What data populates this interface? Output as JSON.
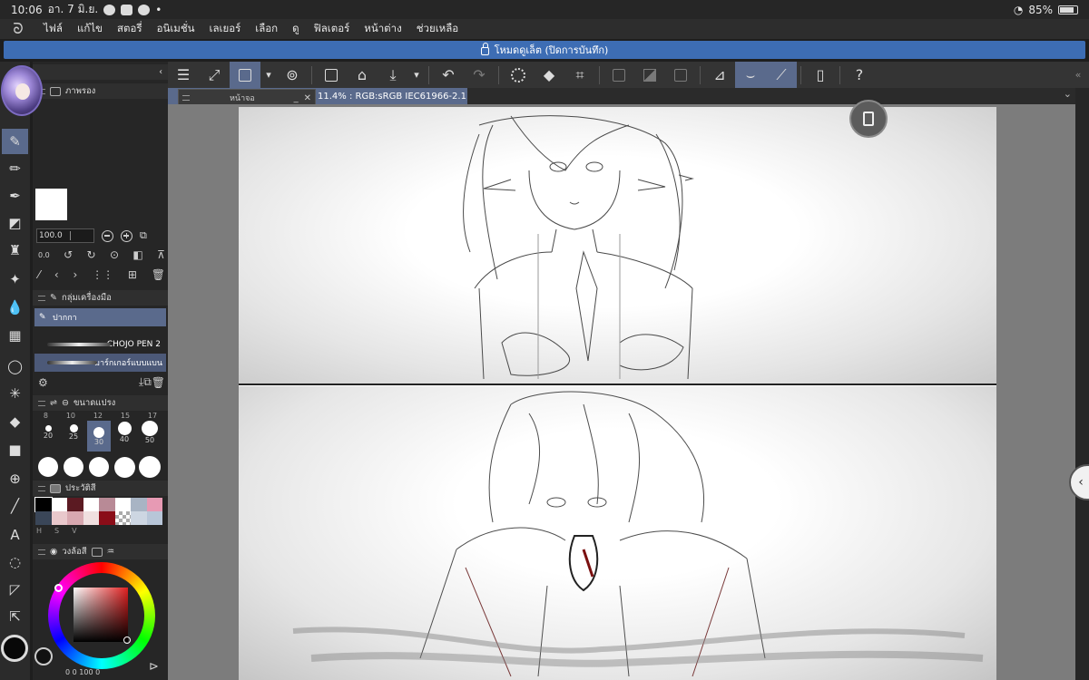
{
  "status_bar": {
    "time": "10:06",
    "date": "อา. 7 มิ.ย.",
    "battery": "85%"
  },
  "menu": [
    "ไฟล์",
    "แก้ไข",
    "สตอรี่",
    "อนิเมชั่น",
    "เลเยอร์",
    "เลือก",
    "ดู",
    "ฟิลเตอร์",
    "หน้าต่าง",
    "ช่วยเหลือ"
  ],
  "banner": {
    "text": "โหมดดูเล็ต (ปิดการบันทึก)"
  },
  "document_tab": {
    "title": "11.4% : RGB:sRGB IEC61966-2.1)",
    "modified": "●"
  },
  "navigator": {
    "title": "หน้าจอ"
  },
  "layer_panel": {
    "title": "ภาพรอง",
    "opacity": "100.0",
    "angle": "0.0"
  },
  "subtool_panel": {
    "title": "กลุ่มเครื่องมือ",
    "items": [
      {
        "label": "ปากกา"
      },
      {
        "label": "CHOJO PEN 2"
      },
      {
        "label": "มาร์กเกอร์แบบแบน"
      }
    ]
  },
  "brush_size_panel": {
    "title": "ขนาดแปรง",
    "top_row": [
      "8",
      "10",
      "12",
      "15",
      "17"
    ],
    "row1": [
      "20",
      "25",
      "30",
      "40",
      "50"
    ],
    "selected": "30"
  },
  "color_history_panel": {
    "title": "ประวัติสี",
    "swatches": [
      "#000000",
      "#ffffff",
      "#5b1a22",
      "#ffffff",
      "#b88a96",
      "#ffffff",
      "#a8b4c4",
      "#e79ab4",
      "#3a4658",
      "#e9c8cc",
      "#d8a8b0",
      "#f0e0e0",
      "#8a0d18",
      "checker",
      "#cdd6e2",
      "#b8c6d8"
    ],
    "labels": [
      "H",
      "S",
      "V"
    ]
  },
  "color_wheel_panel": {
    "title": "วงล้อสี",
    "h": "0",
    "s": "0",
    "v": "100",
    "extra": "0"
  },
  "colors": {
    "accent": "#5a6a8c",
    "banner": "#3d6db4"
  },
  "command_icons": [
    "menu-icon",
    "fit-icon",
    "pen-tool-icon",
    "chevron-down-icon",
    "record-icon",
    "new-icon",
    "open-icon",
    "save-icon",
    "undo-icon",
    "redo-icon",
    "loading-icon",
    "fill-icon",
    "transform-icon",
    "selection-icons",
    "ruler-icons",
    "pen-pressure-icons",
    "device-icon",
    "help-icon"
  ]
}
